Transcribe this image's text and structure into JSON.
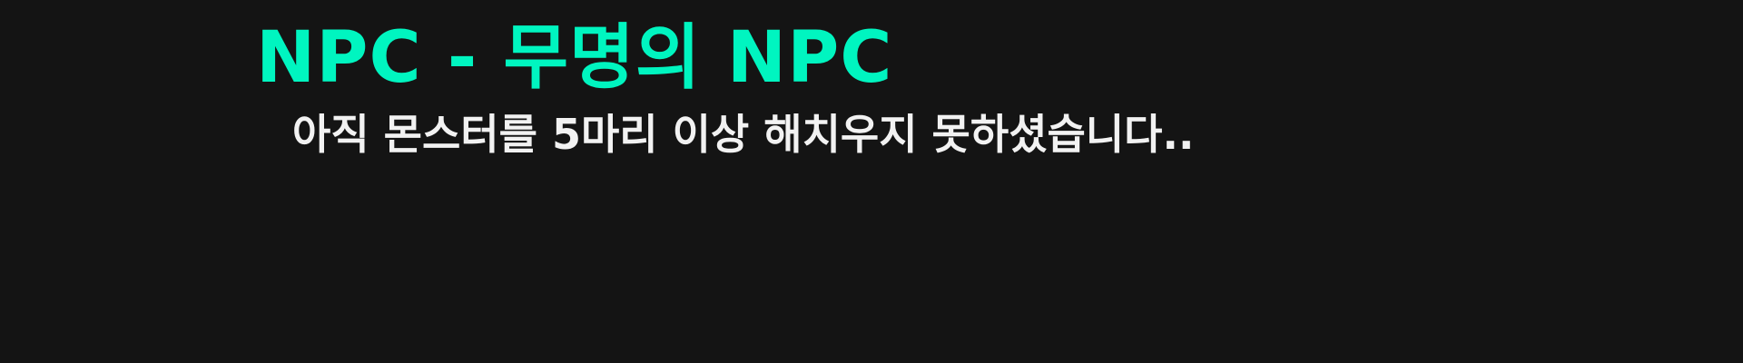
{
  "dialog": {
    "speaker": "NPC - 무명의 NPC",
    "message": "아직 몬스터를 5마리 이상 해치우지 못하셨습니다.."
  },
  "colors": {
    "background": "#141414",
    "speaker": "#00f5c0",
    "message": "#f2f2f2"
  }
}
